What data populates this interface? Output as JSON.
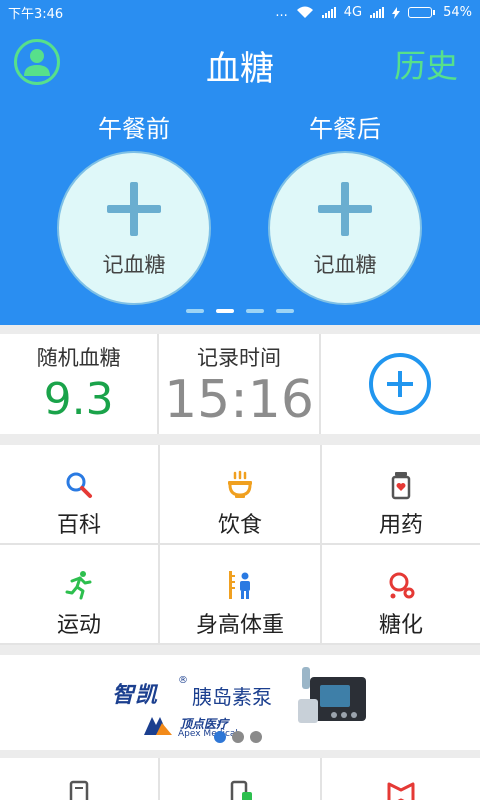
{
  "status_bar": {
    "time": "下午3:46",
    "dots": "...",
    "network": "4G",
    "battery": "54%",
    "battery_level": 0.54
  },
  "header": {
    "title": "血糖",
    "history_label": "历史",
    "meals": [
      {
        "label": "午餐前",
        "action": "记血糖"
      },
      {
        "label": "午餐后",
        "action": "记血糖"
      }
    ],
    "pager": {
      "count": 4,
      "active_index": 1
    }
  },
  "reading": {
    "type_label": "随机血糖",
    "value": "9.3",
    "time_label": "记录时间",
    "time_value": "15:16",
    "value_color": "#1aa34a"
  },
  "features": [
    {
      "label": "百科",
      "icon": "search-icon"
    },
    {
      "label": "饮食",
      "icon": "bowl-icon"
    },
    {
      "label": "用药",
      "icon": "medicine-bottle-icon"
    },
    {
      "label": "运动",
      "icon": "running-icon"
    },
    {
      "label": "身高体重",
      "icon": "height-weight-icon"
    },
    {
      "label": "糖化",
      "icon": "molecule-icon"
    }
  ],
  "banner": {
    "brand": "智凯",
    "registered": "®",
    "product": "胰岛素泵",
    "maker_cn": "顶点医疗",
    "maker_en": "Apex Medical",
    "dots": {
      "count": 3,
      "active_index": 0
    }
  },
  "bottom_icons": [
    "calculator-icon",
    "device-icon",
    "book-icon"
  ],
  "colors": {
    "primary_blue": "#2a8ef1",
    "accent_green": "#57e08b",
    "value_green": "#1aa34a",
    "add_blue": "#2196ef"
  }
}
